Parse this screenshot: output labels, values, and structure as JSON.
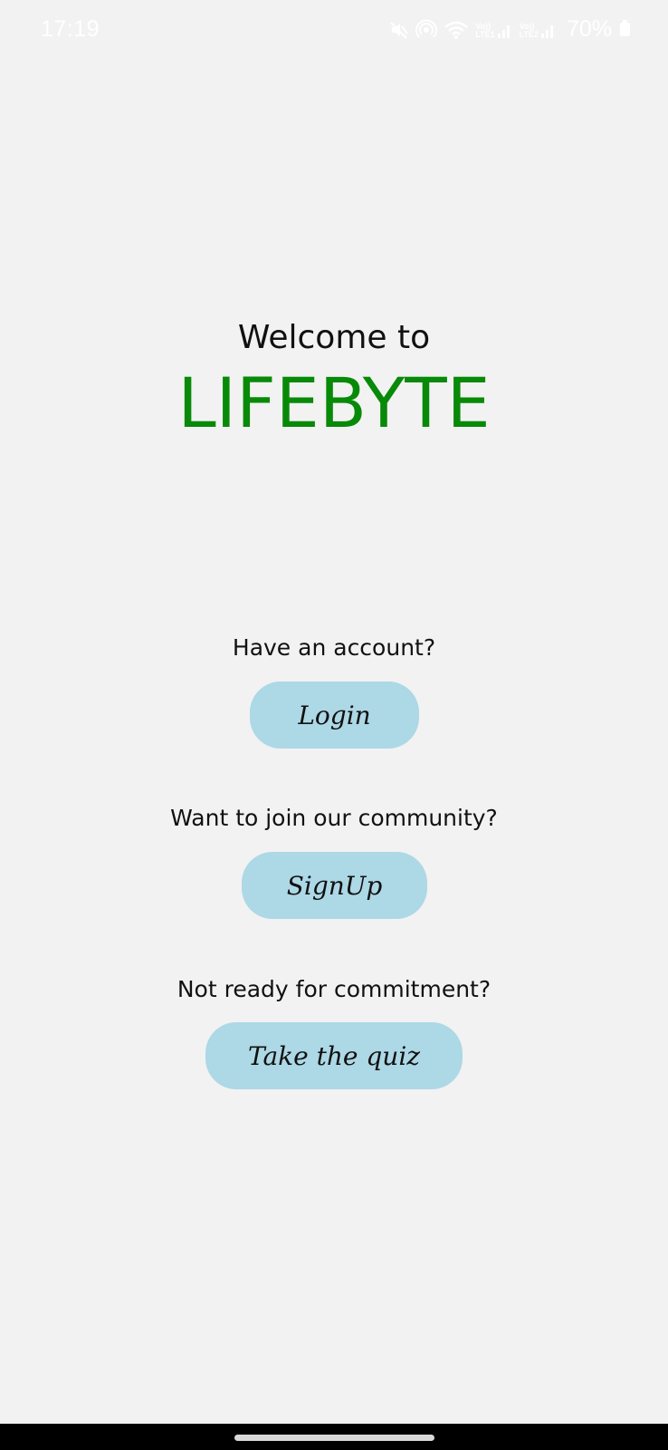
{
  "status_bar": {
    "time": "17:19",
    "battery": "70%",
    "sim1_label_top": "Vo))",
    "sim1_label_bottom": "LTE1",
    "sim2_label_top": "Vo))",
    "sim2_label_bottom": "LTE2",
    "icons": [
      "mute-icon",
      "hotspot-icon",
      "wifi-icon",
      "signal-icon",
      "signal-icon",
      "battery-icon"
    ]
  },
  "welcome": {
    "line1": "Welcome to",
    "brand": "LIFEBYTE",
    "brand_color": "#088a08"
  },
  "actions": {
    "login_prompt": "Have an account?",
    "login_label": "Login",
    "signup_prompt": "Want to join our community?",
    "signup_label": "SignUp",
    "quiz_prompt": "Not ready for commitment?",
    "quiz_label": "Take the quiz",
    "button_color": "#add8e6"
  }
}
